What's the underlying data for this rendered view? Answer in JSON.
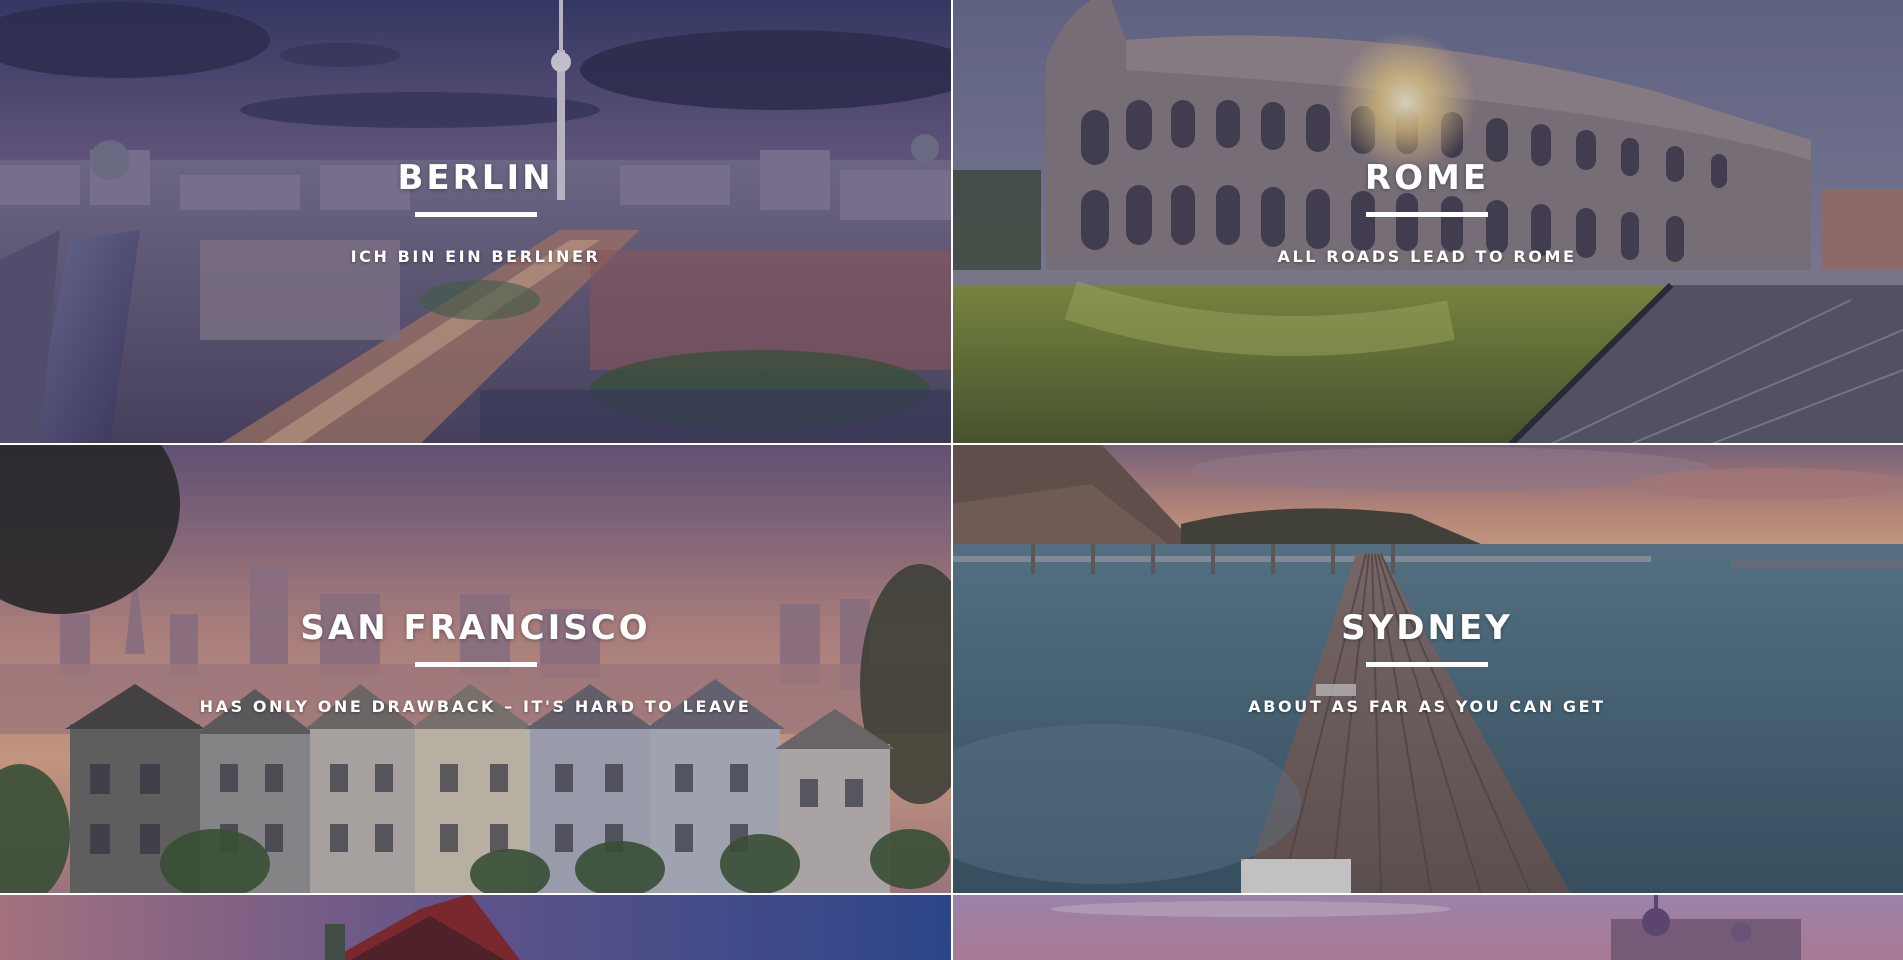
{
  "tiles": [
    {
      "city": "BERLIN",
      "tagline": "ICH BIN EIN BERLINER",
      "scene": "berlin-skyline-image"
    },
    {
      "city": "ROME",
      "tagline": "ALL ROADS LEAD TO ROME",
      "scene": "rome-colosseum-image"
    },
    {
      "city": "SAN FRANCISCO",
      "tagline": "HAS ONLY ONE DRAWBACK – IT'S HARD TO LEAVE",
      "scene": "san-francisco-painted-ladies-image"
    },
    {
      "city": "SYDNEY",
      "tagline": "ABOUT AS FAR AS YOU CAN GET",
      "scene": "sydney-pier-image"
    },
    {
      "city": "",
      "tagline": "",
      "scene": "temple-roof-image"
    },
    {
      "city": "",
      "tagline": "",
      "scene": "palace-domes-image"
    }
  ],
  "colors": {
    "text": "#ffffff",
    "rule": "#ffffff",
    "overlay": "#1e1a3c"
  }
}
